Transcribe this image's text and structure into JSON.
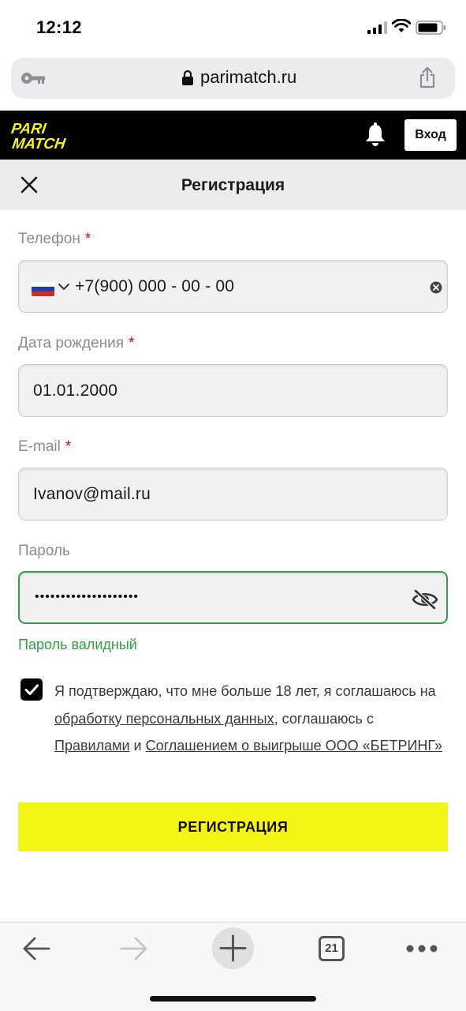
{
  "status_bar": {
    "time": "12:12"
  },
  "browser": {
    "url": "parimatch.ru",
    "tab_count": "21"
  },
  "site_header": {
    "logo_line1": "PARI",
    "logo_line2": "MATCH",
    "login_label": "Вход"
  },
  "registration": {
    "title": "Регистрация",
    "phone_label": "Телефон",
    "phone_value": "+7(900) 000 - 00 - 00",
    "birth_label": "Дата рождения",
    "birth_value": "01.01.2000",
    "email_label": "E-mail",
    "email_value": "Ivanov@mail.ru",
    "password_label": "Пароль",
    "password_masked": "••••••••••••••••••••",
    "password_status": "Пароль валидный",
    "required_mark": "*",
    "agreement": {
      "part1": "Я подтверждаю, что мне больше 18 лет, я соглашаюсь на ",
      "link1": "обработку персональных данных",
      "part2": ", соглашаюсь с ",
      "link2": "Правилами",
      "part3": " и ",
      "link3": "Соглашением о выигрыше ООО «БЕТРИНГ»",
      "checked": true
    },
    "submit_label": "РЕГИСТРАЦИЯ"
  },
  "colors": {
    "brand_yellow": "#f4f515",
    "valid_green": "#2fa046",
    "required_red": "#d0021b",
    "header_black": "#000000"
  }
}
